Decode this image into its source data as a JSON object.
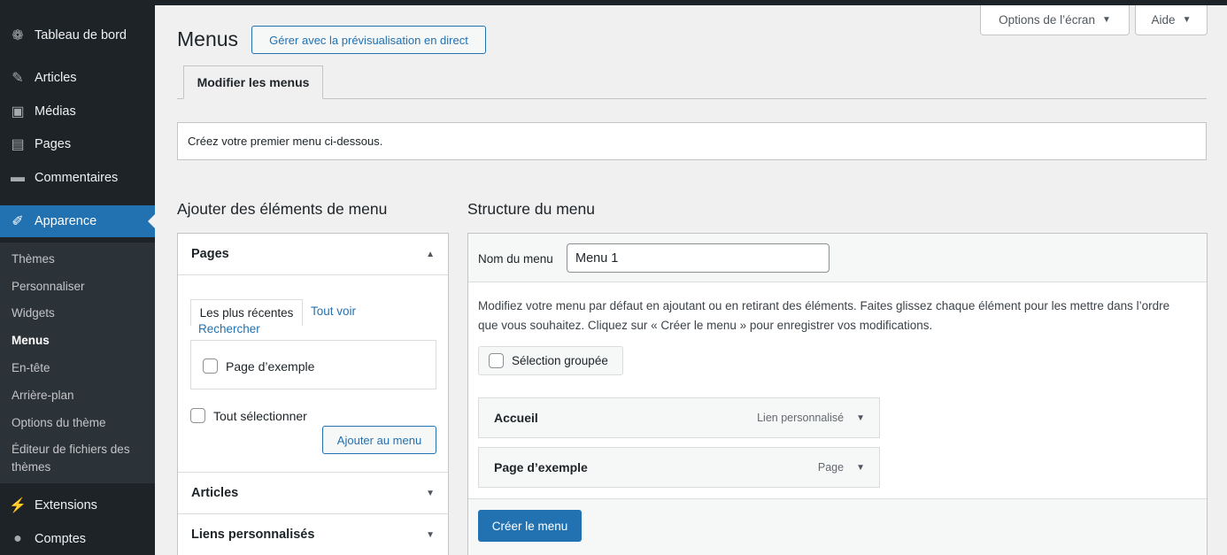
{
  "sidebar": {
    "items": [
      {
        "label": "Tableau de bord",
        "icon": "dashboard-icon",
        "glyph": "❁"
      },
      {
        "label": "Articles",
        "icon": "pin-icon",
        "glyph": "✎"
      },
      {
        "label": "Médias",
        "icon": "media-icon",
        "glyph": "▣"
      },
      {
        "label": "Pages",
        "icon": "pages-icon",
        "glyph": "▤"
      },
      {
        "label": "Commentaires",
        "icon": "comment-icon",
        "glyph": "▬"
      },
      {
        "label": "Apparence",
        "icon": "brush-icon",
        "glyph": "✐"
      },
      {
        "label": "Extensions",
        "icon": "plugin-icon",
        "glyph": "⚡"
      },
      {
        "label": "Comptes",
        "icon": "user-icon",
        "glyph": "●"
      }
    ],
    "submenu": [
      "Thèmes",
      "Personnaliser",
      "Widgets",
      "Menus",
      "En-tête",
      "Arrière-plan",
      "Options du thème",
      "Éditeur de fichiers des",
      "thèmes"
    ]
  },
  "header": {
    "title": "Menus",
    "live_preview": "Gérer avec la prévisualisation en direct",
    "screen_options": "Options de l’écran",
    "help": "Aide",
    "tab": "Modifier les menus"
  },
  "notice": "Créez votre premier menu ci-dessous.",
  "left": {
    "heading": "Ajouter des éléments de menu",
    "pages_title": "Pages",
    "tab_recent": "Les plus récentes",
    "tab_all": "Tout voir",
    "tab_search": "Rechercher",
    "page_item": "Page d’exemple",
    "select_all": "Tout sélectionner",
    "add_button": "Ajouter au menu",
    "articles_title": "Articles",
    "links_title": "Liens personnalisés"
  },
  "right": {
    "heading": "Structure du menu",
    "name_label": "Nom du menu",
    "name_value": "Menu 1",
    "description": "Modifiez votre menu par défaut en ajoutant ou en retirant des éléments. Faites glissez chaque élément pour les mettre dans l’ordre que vous souhaitez. Cliquez sur « Créer le menu » pour enregistrer vos modifications.",
    "bulk_select": "Sélection groupée",
    "items": [
      {
        "title": "Accueil",
        "type": "Lien personnalisé"
      },
      {
        "title": "Page d’exemple",
        "type": "Page"
      }
    ],
    "create_button": "Créer le menu"
  },
  "colors": {
    "accent": "#2271b1",
    "sidebar": "#1d2327",
    "background": "#f0f0f1"
  }
}
